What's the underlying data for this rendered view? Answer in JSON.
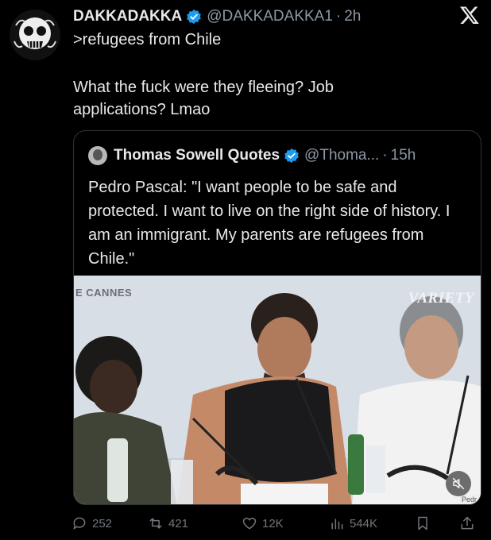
{
  "tweet": {
    "author_name": "DAKKADAKKA",
    "author_handle": "@DAKKADAKKA1",
    "separator": "·",
    "time": "2h",
    "text_line1": ">refugees from Chile",
    "text_line2": "What the fuck were they fleeing? Job",
    "text_line3": "applications? Lmao"
  },
  "quote": {
    "author_name": "Thomas Sowell Quotes",
    "author_handle": "@Thoma...",
    "separator": "·",
    "time": "15h",
    "text": "Pedro Pascal: \"I want people to be safe and protected. I want to live on the right side of history. I am an immigrant. My parents are refugees from Chile.\"",
    "image": {
      "cannes_label": "E CANNES",
      "variety_logo": "VARIETY",
      "name_card": "Pedr"
    }
  },
  "actions": {
    "replies": "252",
    "reposts": "421",
    "likes": "12K",
    "views": "544K"
  },
  "colors": {
    "background": "#000000",
    "text": "#e7e9ea",
    "secondary": "#8b98a5",
    "verified": "#1d9bf0"
  }
}
